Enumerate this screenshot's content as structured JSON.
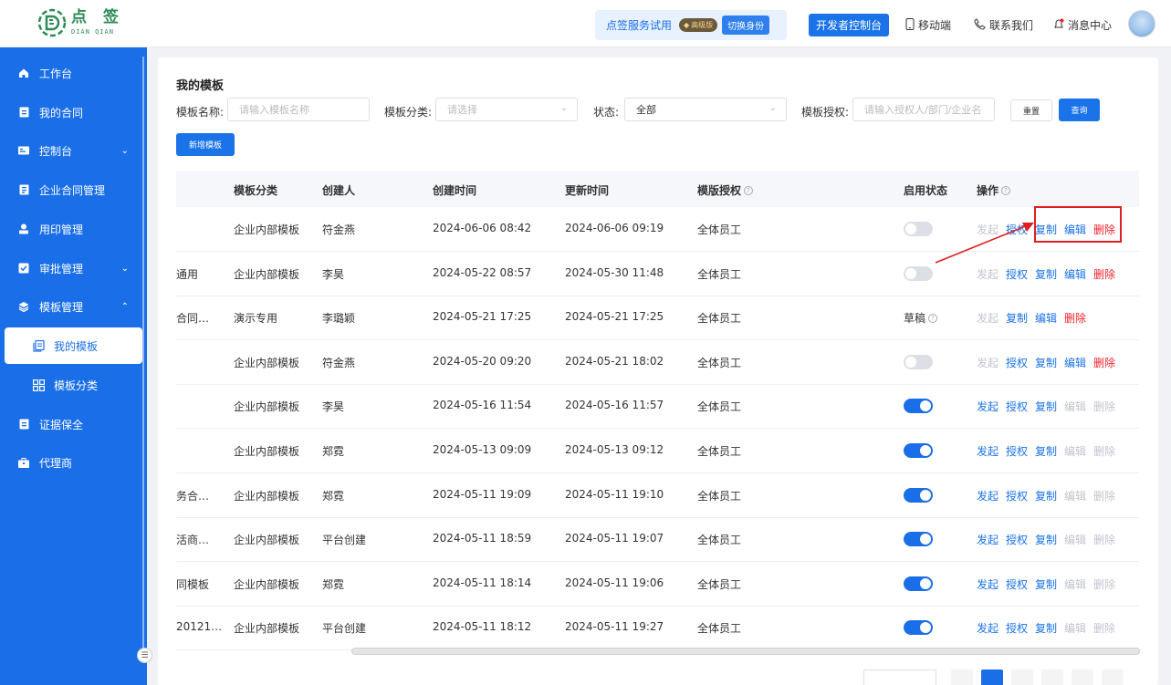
{
  "header": {
    "logo_cn": "点 签",
    "logo_en": "DIAN QIAN",
    "trial_text": "点签服务试用",
    "tier_badge": "高级版",
    "switch_identity": "切换身份",
    "dev_console": "开发者控制台",
    "mobile": "移动端",
    "contact": "联系我们",
    "messages": "消息中心"
  },
  "sidebar": {
    "items": [
      {
        "label": "工作台",
        "icon": "home-icon"
      },
      {
        "label": "我的合同",
        "icon": "contract-icon"
      },
      {
        "label": "控制台",
        "icon": "console-icon"
      },
      {
        "label": "企业合同管理",
        "icon": "document-icon"
      },
      {
        "label": "用印管理",
        "icon": "seal-icon"
      },
      {
        "label": "审批管理",
        "icon": "approval-icon"
      },
      {
        "label": "模板管理",
        "icon": "layers-icon"
      },
      {
        "label": "我的模板",
        "icon": "template-icon"
      },
      {
        "label": "模板分类",
        "icon": "grid-icon"
      },
      {
        "label": "证据保全",
        "icon": "evidence-icon"
      },
      {
        "label": "代理商",
        "icon": "agent-icon"
      }
    ]
  },
  "page": {
    "title": "我的模板",
    "filters": {
      "name_label": "模板名称:",
      "name_placeholder": "请输入模板名称",
      "category_label": "模板分类:",
      "category_placeholder": "请选择",
      "status_label": "状态:",
      "status_value": "全部",
      "auth_label": "模板授权:",
      "auth_placeholder": "请输入授权人/部门/企业名"
    },
    "reset": "重置",
    "query": "查询",
    "new_template": "新增模板"
  },
  "table": {
    "headers": {
      "category": "模板分类",
      "creator": "创建人",
      "created": "创建时间",
      "updated": "更新时间",
      "auth": "模版授权",
      "status": "启用状态",
      "ops": "操作"
    },
    "rows": [
      {
        "name": "",
        "category": "企业内部模板",
        "creator": "符金燕",
        "created": "2024-06-06 08:42",
        "updated": "2024-06-06 09:19",
        "auth": "全体员工",
        "enabled": false
      },
      {
        "name": "通用",
        "category": "企业内部模板",
        "creator": "李昊",
        "created": "2024-05-22 08:57",
        "updated": "2024-05-30 11:48",
        "auth": "全体员工",
        "enabled": false
      },
      {
        "name": "合同…",
        "category": "演示专用",
        "creator": "李璐颖",
        "created": "2024-05-21 17:25",
        "updated": "2024-05-21 17:25",
        "auth": "全体员工",
        "status_text": "草稿"
      },
      {
        "name": "",
        "category": "企业内部模板",
        "creator": "符金燕",
        "created": "2024-05-20 09:20",
        "updated": "2024-05-21 18:02",
        "auth": "全体员工",
        "enabled": false
      },
      {
        "name": "",
        "category": "企业内部模板",
        "creator": "李昊",
        "created": "2024-05-16 11:54",
        "updated": "2024-05-16 11:57",
        "auth": "全体员工",
        "enabled": true
      },
      {
        "name": "",
        "category": "企业内部模板",
        "creator": "郑霓",
        "created": "2024-05-13 09:09",
        "updated": "2024-05-13 09:12",
        "auth": "全体员工",
        "enabled": true
      },
      {
        "name": "务合…",
        "category": "企业内部模板",
        "creator": "郑霓",
        "created": "2024-05-11 19:09",
        "updated": "2024-05-11 19:10",
        "auth": "全体员工",
        "enabled": true
      },
      {
        "name": "活商…",
        "category": "企业内部模板",
        "creator": "平台创建",
        "created": "2024-05-11 18:59",
        "updated": "2024-05-11 19:07",
        "auth": "全体员工",
        "enabled": true
      },
      {
        "name": "同模板",
        "category": "企业内部模板",
        "creator": "郑霓",
        "created": "2024-05-11 18:14",
        "updated": "2024-05-11 19:06",
        "auth": "全体员工",
        "enabled": true
      },
      {
        "name": "20121…",
        "category": "企业内部模板",
        "creator": "平台创建",
        "created": "2024-05-11 18:12",
        "updated": "2024-05-11 19:27",
        "auth": "全体员工",
        "enabled": true
      }
    ],
    "ops": {
      "launch": "发起",
      "authorize": "授权",
      "copy": "复制",
      "edit": "编辑",
      "delete": "删除"
    }
  },
  "colors": {
    "brand": "#1a6fe8",
    "danger": "#f5222d",
    "highlight": "#e02020"
  }
}
